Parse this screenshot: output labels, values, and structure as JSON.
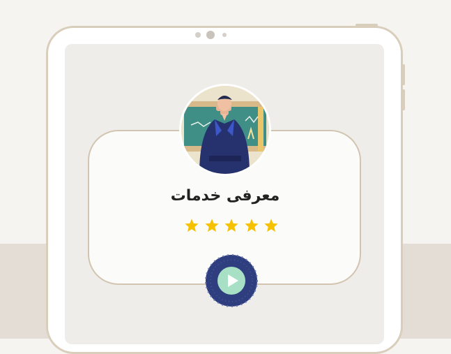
{
  "card": {
    "title": "معرفی خدمات",
    "rating": {
      "value": 5,
      "max": 5,
      "star_color": "#f6c100"
    }
  },
  "avatar": {
    "label": "",
    "icon": "presenter-illustration"
  },
  "play": {
    "icon": "play-icon",
    "accent": "#a8e0c6"
  },
  "colors": {
    "page_bg": "#f6f4f1",
    "band": "#e3ddd6",
    "tablet_frame": "#d9cdbb",
    "screen_bg": "#efedea",
    "play_ring": "#2e3e7e"
  }
}
